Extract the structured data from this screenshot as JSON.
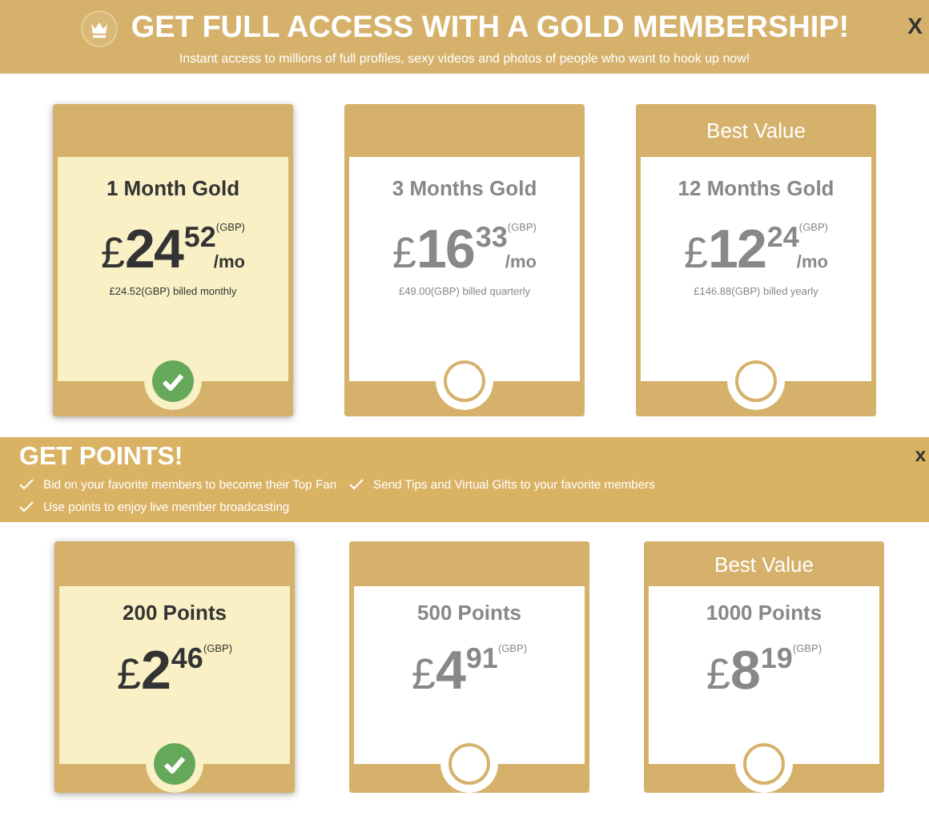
{
  "membership": {
    "title": "GET FULL ACCESS WITH A GOLD MEMBERSHIP!",
    "subtitle": "Instant access to millions of full profiles, sexy videos and photos of people who want to hook up now!",
    "close": "X",
    "plans": [
      {
        "name": "1 Month Gold",
        "currency": "£",
        "whole": "24",
        "cents": "52",
        "code": "(GBP)",
        "per": "/mo",
        "billing": "£24.52(GBP) billed monthly",
        "selected": true
      },
      {
        "name": "3 Months Gold",
        "currency": "£",
        "whole": "16",
        "cents": "33",
        "code": "(GBP)",
        "per": "/mo",
        "billing": "£49.00(GBP) billed quarterly",
        "selected": false
      },
      {
        "badge": "Best Value",
        "name": "12 Months Gold",
        "currency": "£",
        "whole": "12",
        "cents": "24",
        "code": "(GBP)",
        "per": "/mo",
        "billing": "£146.88(GBP) billed yearly",
        "selected": false
      }
    ]
  },
  "points": {
    "title": "GET POINTS!",
    "close": "x",
    "features": [
      "Bid on your favorite members to become their Top Fan",
      "Send Tips and Virtual Gifts to your favorite members",
      "Use points to enjoy live member broadcasting"
    ],
    "packages": [
      {
        "name": "200 Points",
        "currency": "£",
        "whole": "2",
        "cents": "46",
        "code": "(GBP)",
        "selected": true
      },
      {
        "name": "500 Points",
        "currency": "£",
        "whole": "4",
        "cents": "91",
        "code": "(GBP)",
        "selected": false
      },
      {
        "badge": "Best Value",
        "name": "1000 Points",
        "currency": "£",
        "whole": "8",
        "cents": "19",
        "code": "(GBP)",
        "selected": false
      }
    ]
  }
}
